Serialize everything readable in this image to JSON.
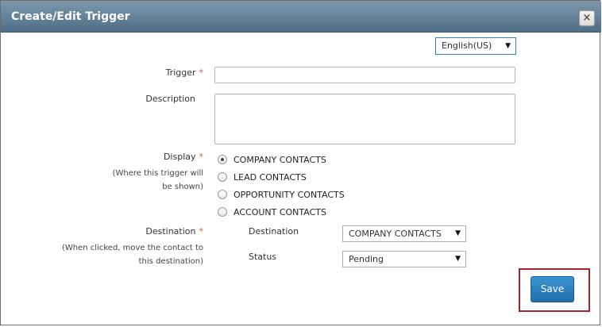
{
  "dialog": {
    "title": "Create/Edit Trigger",
    "close_label": "×"
  },
  "language": {
    "selected": "English(US)"
  },
  "form": {
    "required_marker": "*",
    "trigger_label": "Trigger",
    "trigger_value": "",
    "description_label": "Description",
    "description_value": "",
    "display_label": "Display",
    "display_hint_line1": "(Where this trigger will",
    "display_hint_line2": "be shown)",
    "display_options": [
      {
        "label": "COMPANY CONTACTS",
        "checked": true
      },
      {
        "label": "LEAD CONTACTS",
        "checked": false
      },
      {
        "label": "OPPORTUNITY CONTACTS",
        "checked": false
      },
      {
        "label": "ACCOUNT CONTACTS",
        "checked": false
      }
    ],
    "destination_label": "Destination",
    "destination_hint_line1": "(When clicked, move the contact to",
    "destination_hint_line2": "this destination)",
    "dest_sub_label": "Destination",
    "dest_sub_value": "COMPANY CONTACTS",
    "status_label": "Status",
    "status_value": "Pending"
  },
  "actions": {
    "save_label": "Save"
  },
  "colors": {
    "titlebar": "#5f7c94",
    "required": "#d9534f",
    "save_button": "#2a82bf",
    "highlight_border": "#a8232b"
  }
}
